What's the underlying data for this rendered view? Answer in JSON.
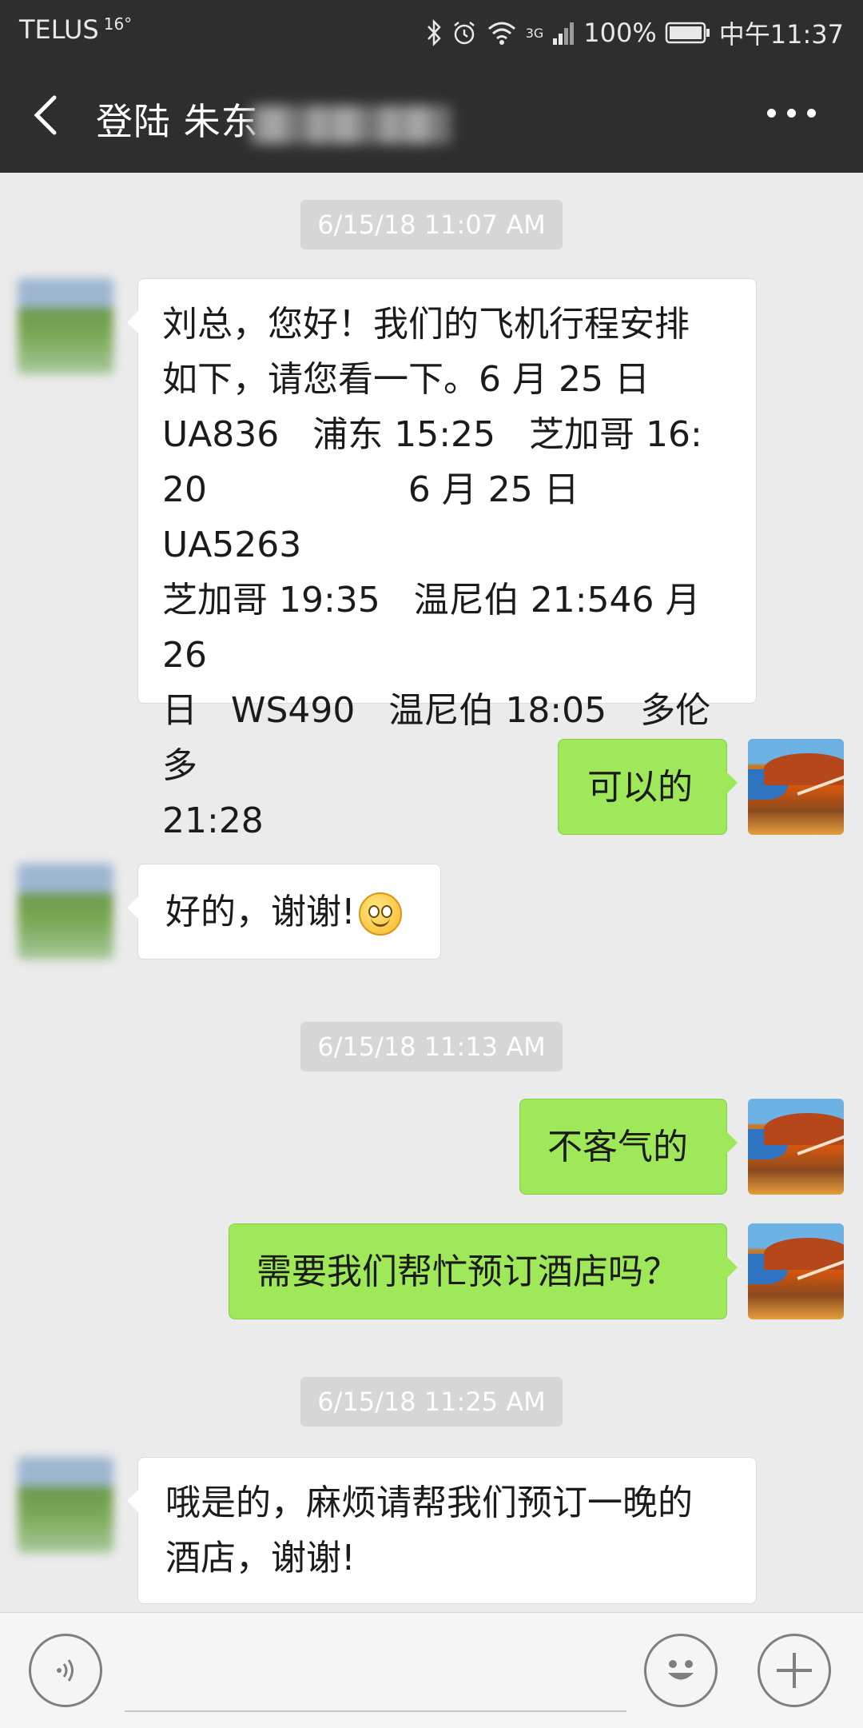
{
  "status_bar": {
    "carrier": "TELUS",
    "signal_note": "16°",
    "network": "3G",
    "battery": "100%",
    "time": "中午11:37"
  },
  "header": {
    "title": "登陆 朱东"
  },
  "messages": [
    {
      "type": "timestamp",
      "text": "6/15/18 11:07 AM"
    },
    {
      "type": "incoming",
      "text": "刘总，您好！我们的飞机行程安排\n如下，请您看一下。6 月 25 日\nUA836   浦东 15:25   芝加哥 16:\n20                  6 月 25 日   UA5263\n芝加哥 19:35   温尼伯 21:546 月 26\n日   WS490   温尼伯 18:05   多伦多\n21:28"
    },
    {
      "type": "outgoing",
      "text": "可以的"
    },
    {
      "type": "incoming",
      "text": "好的，谢谢!",
      "emoji": "smile-emoji"
    },
    {
      "type": "timestamp",
      "text": "6/15/18 11:13 AM"
    },
    {
      "type": "outgoing",
      "text": "不客气的"
    },
    {
      "type": "outgoing",
      "text": "需要我们帮忙预订酒店吗？"
    },
    {
      "type": "timestamp",
      "text": "6/15/18 11:25 AM"
    },
    {
      "type": "incoming",
      "text": "哦是的，麻烦请帮我们预订一晚的\n酒店，谢谢!"
    }
  ],
  "input_bar": {
    "voice_icon": "voice-icon",
    "emoji_icon": "emoji-icon",
    "plus_icon": "plus-icon"
  },
  "colors": {
    "header_bg": "#2e2e2e",
    "chat_bg": "#ebebeb",
    "outgoing_bubble": "#9fe859",
    "incoming_bubble": "#ffffff"
  }
}
